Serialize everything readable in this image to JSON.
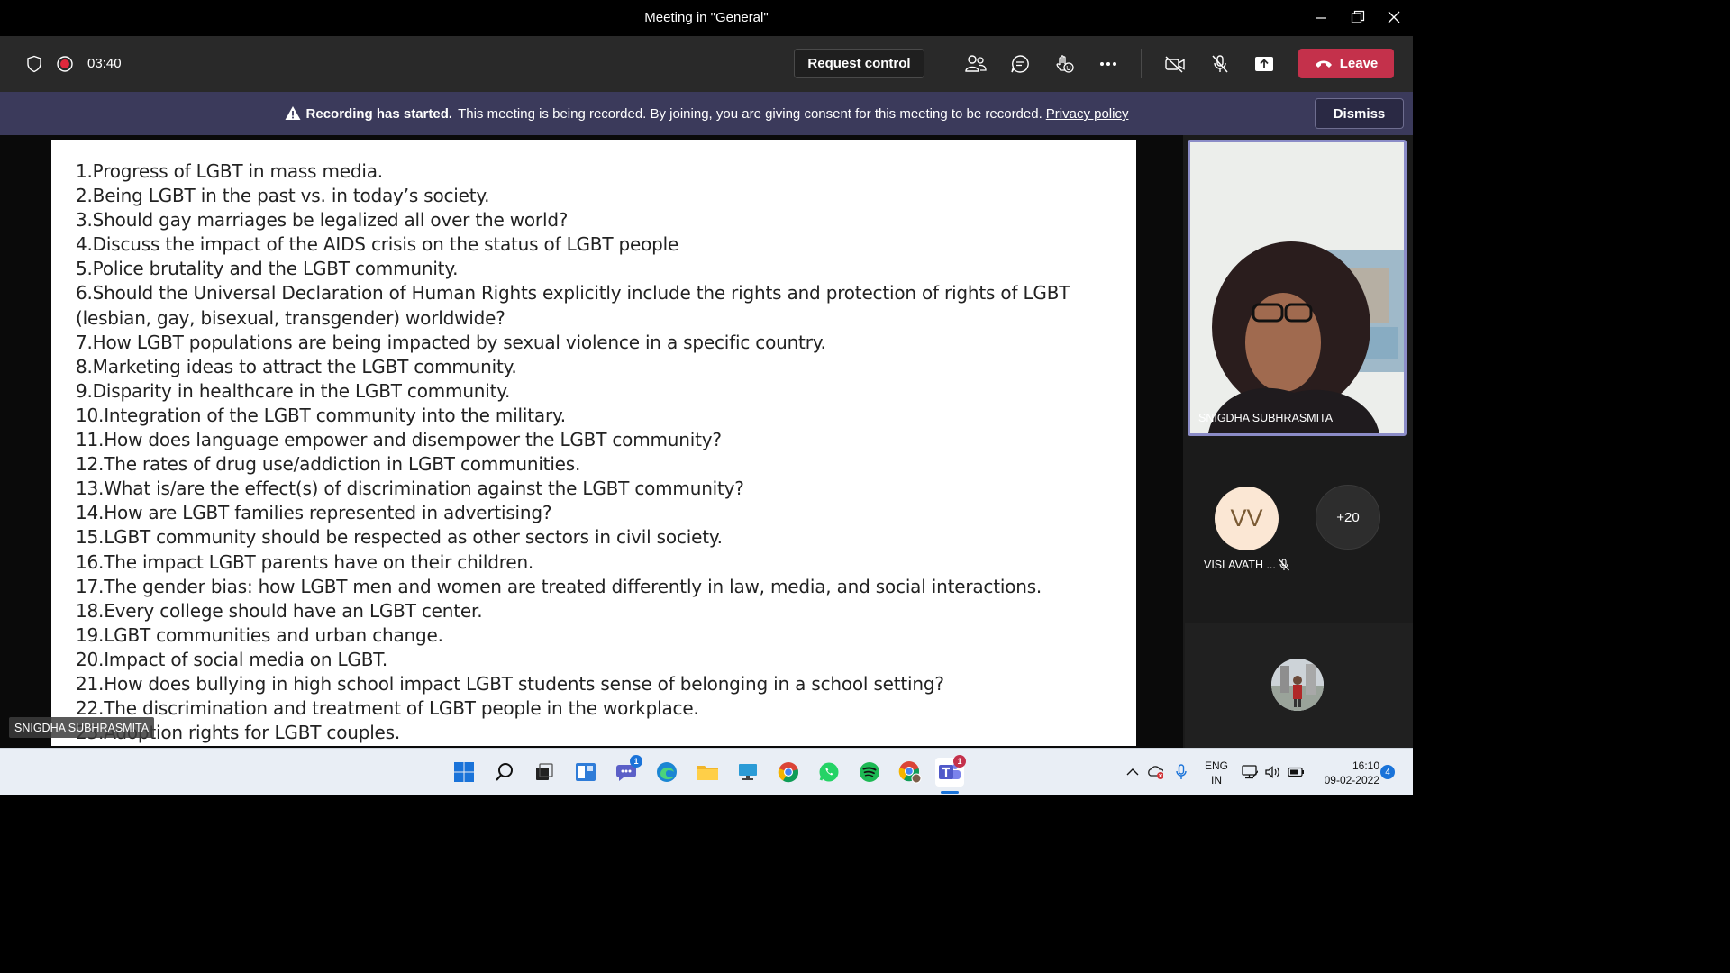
{
  "window": {
    "title": "Meeting in \"General\""
  },
  "meeting_bar": {
    "timer": "03:40",
    "request_control_label": "Request control",
    "leave_label": "Leave"
  },
  "banner": {
    "bold": "Recording has started.",
    "message": "This meeting is being recorded. By joining, you are giving consent for this meeting to be recorded.",
    "link": "Privacy policy",
    "dismiss_label": "Dismiss"
  },
  "slide": {
    "items": [
      "1.Progress of LGBT in mass media.",
      "2.Being LGBT in the past vs. in today’s society.",
      "3.Should gay marriages be legalized all over the world?",
      "4.Discuss the impact of the AIDS crisis on the status of LGBT people",
      "5.Police brutality and the LGBT community.",
      "6.Should the Universal Declaration of Human Rights explicitly include the rights and protection of rights of LGBT",
      "(lesbian, gay, bisexual, transgender) worldwide?",
      "7.How LGBT populations are being impacted by sexual violence in a specific country.",
      "8.Marketing ideas to attract the LGBT community.",
      "9.Disparity in healthcare in the LGBT community.",
      "10.Integration of the LGBT community into the military.",
      "11.How does language empower and disempower the LGBT community?",
      "12.The rates of drug use/addiction in LGBT communities.",
      "13.What is/are the effect(s) of discrimination against the LGBT community?",
      "14.How are LGBT families represented in advertising?",
      "15.LGBT community should be respected as other sectors in civil society.",
      "16.The impact LGBT parents have on their children.",
      "17.The gender bias: how LGBT men and women are treated differently in law, media, and social interactions.",
      "18.Every college should have an LGBT center.",
      "19.LGBT communities and urban change.",
      "20.Impact of social media on LGBT.",
      "21.How does bullying in high school impact LGBT students sense of belonging in a school setting?",
      "22.The discrimination and treatment of LGBT people in the workplace.",
      "23.Adoption rights for LGBT couples."
    ],
    "presenter_label": "SNIGDHA SUBHRASMITA"
  },
  "participants": {
    "speaker_name": "SNIGDHA SUBHRASMITA",
    "vv_initials": "VV",
    "vv_name": "VISLAVATH ...",
    "more_count": "+20"
  },
  "taskbar": {
    "chat_badge": "1",
    "teams_badge": "1",
    "lang_top": "ENG",
    "lang_bottom": "IN",
    "time": "16:10",
    "date": "09-02-2022",
    "notification_count": "4"
  },
  "colors": {
    "leave": "#c4314b",
    "banner": "#3b3a5b",
    "speaker_border": "#8b8cc7",
    "meetbar": "#292929"
  }
}
